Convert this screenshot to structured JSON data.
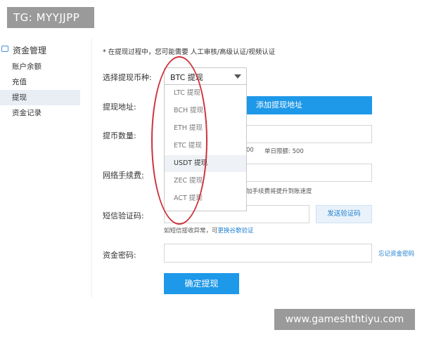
{
  "watermark_top": "TG: MYYJJPP",
  "watermark_bottom": "www.gameshthtiyu.com",
  "sidebar": {
    "title": "资金管理",
    "items": [
      {
        "label": "账户余额"
      },
      {
        "label": "充值"
      },
      {
        "label": "提现",
        "active": true
      },
      {
        "label": "资金记录"
      }
    ]
  },
  "notice": "* 在提现过程中，您可能需要 人工审核/高级认证/视频认证",
  "form": {
    "currency_label": "选择提现币种:",
    "currency_selected": "BTC 提现",
    "currency_options": [
      "LTC 提现",
      "BCH 提现",
      "ETH 提现",
      "ETC 提现",
      "USDT 提现",
      "ZEC 提现",
      "ACT 提现"
    ],
    "highlighted_option": "USDT 提现",
    "address_label": "提现地址:",
    "add_address_button": "添加提现地址",
    "amount_label": "提币数量:",
    "amount_hint_partial": "00",
    "single_limit": "单日限额: 500",
    "fee_label": "网络手续费:",
    "fee_hint": "加手续费将提升到账速度",
    "sms_label": "短信验证码:",
    "send_code_button": "发送验证码",
    "sms_hint_prefix": "如短信接收异常，可",
    "sms_hint_link": "更换谷歌验证",
    "password_label": "资金密码:",
    "forgot_password": "忘记资金密码",
    "confirm_button": "确定提现"
  },
  "colors": {
    "primary": "#1e98e8",
    "annotation": "#d0303a",
    "link": "#1e7fd0"
  }
}
